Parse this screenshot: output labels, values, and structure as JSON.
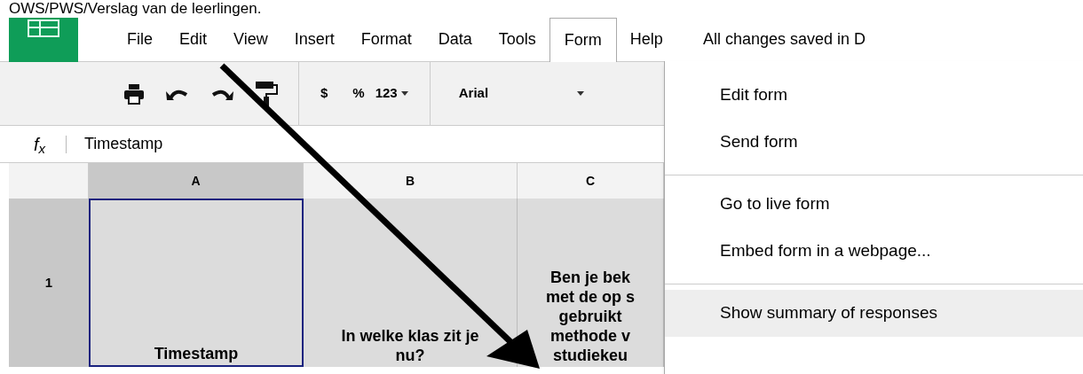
{
  "caption": "OWS/PWS/Verslag van de leerlingen.",
  "menubar": {
    "items": [
      {
        "label": "File",
        "selected": false
      },
      {
        "label": "Edit",
        "selected": false
      },
      {
        "label": "View",
        "selected": false
      },
      {
        "label": "Insert",
        "selected": false
      },
      {
        "label": "Format",
        "selected": false
      },
      {
        "label": "Data",
        "selected": false
      },
      {
        "label": "Tools",
        "selected": false
      },
      {
        "label": "Form",
        "selected": true
      },
      {
        "label": "Help",
        "selected": false
      }
    ],
    "status": "All changes saved in D"
  },
  "toolbar": {
    "currency": "$",
    "percent": "%",
    "number_format": "123",
    "font": "Arial"
  },
  "formula_bar": {
    "label": "f$_{x}$",
    "value": "Timestamp"
  },
  "sheet": {
    "columns": [
      {
        "label": "A",
        "selected": true
      },
      {
        "label": "B",
        "selected": false
      },
      {
        "label": "C",
        "selected": false
      }
    ],
    "rows": [
      {
        "label": "1",
        "cells": [
          {
            "text": "Timestamp",
            "selected": true
          },
          {
            "text": "In welke klas zit je\nnu?",
            "selected": false
          },
          {
            "text": "Ben je bek\nmet de op s\ngebruikt\nmethode v\nstudiekeu",
            "selected": false
          }
        ]
      }
    ]
  },
  "form_menu": {
    "groups": [
      [
        {
          "label": "Edit form",
          "selected": false
        },
        {
          "label": "Send form",
          "selected": false
        }
      ],
      [
        {
          "label": "Go to live form",
          "selected": false
        },
        {
          "label": "Embed form in a webpage...",
          "selected": false
        }
      ],
      [
        {
          "label": "Show summary of responses",
          "selected": true
        }
      ]
    ]
  }
}
